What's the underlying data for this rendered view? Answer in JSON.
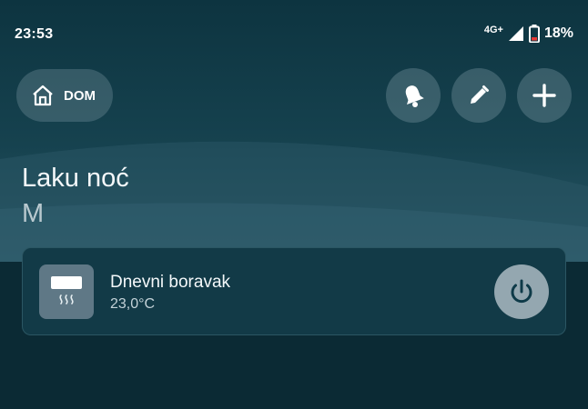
{
  "status_bar": {
    "time": "23:53",
    "network": "4G+",
    "battery": "18%",
    "icons": [
      "signal-icon",
      "battery-low-icon"
    ]
  },
  "header": {
    "home_label": "DOM",
    "home_icon": "house-icon",
    "actions": [
      "bell-icon",
      "pencil-icon",
      "plus-icon"
    ]
  },
  "greeting": {
    "text": "Laku noć",
    "user": "M"
  },
  "devices": [
    {
      "name": "Dnevni boravak",
      "temperature": "23,0°C",
      "icon": "air-conditioner-heat-icon",
      "power_icon": "power-icon"
    }
  ],
  "colors": {
    "background": "#0b2a34",
    "card": "#123a47",
    "chip": "#5a7a85",
    "power_button": "#94a7b0",
    "battery_low": "#e53935"
  }
}
